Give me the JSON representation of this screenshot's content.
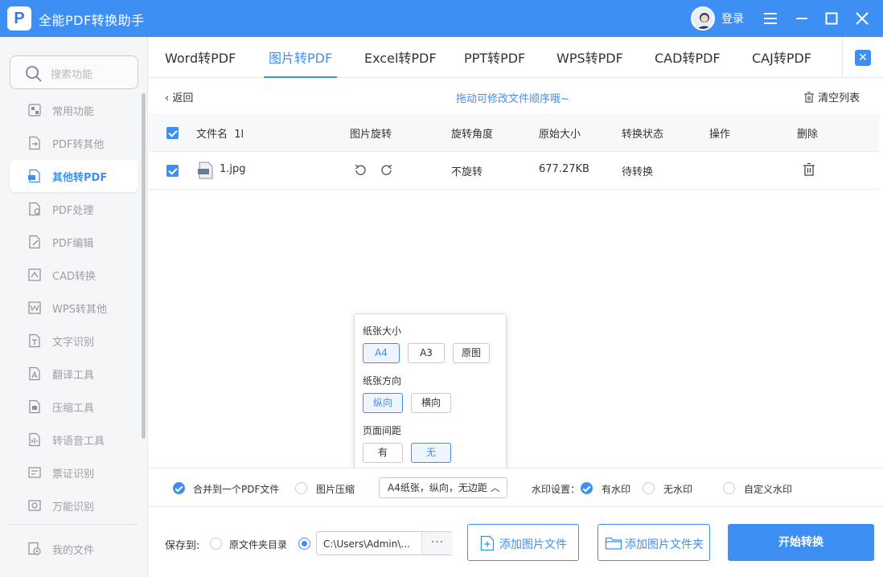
{
  "app": {
    "title": "全能PDF转换助手",
    "login": "登录"
  },
  "search": {
    "placeholder": "搜索功能"
  },
  "sidebar": {
    "items": [
      {
        "label": "常用功能",
        "icon": "common-icon"
      },
      {
        "label": "PDF转其他",
        "icon": "pdf-to-other-icon"
      },
      {
        "label": "其他转PDF",
        "icon": "other-to-pdf-icon",
        "active": true
      },
      {
        "label": "PDF处理",
        "icon": "pdf-process-icon"
      },
      {
        "label": "PDF编辑",
        "icon": "pdf-edit-icon"
      },
      {
        "label": "CAD转换",
        "icon": "cad-icon"
      },
      {
        "label": "WPS转其他",
        "icon": "wps-icon"
      },
      {
        "label": "文字识别",
        "icon": "ocr-icon"
      },
      {
        "label": "翻译工具",
        "icon": "translate-icon"
      },
      {
        "label": "压缩工具",
        "icon": "compress-icon"
      },
      {
        "label": "转语音工具",
        "icon": "speech-icon"
      },
      {
        "label": "票证识别",
        "icon": "ticket-icon"
      },
      {
        "label": "万能识别",
        "icon": "universal-icon"
      }
    ],
    "my_files": "我的文件"
  },
  "tabs": [
    "Word转PDF",
    "图片转PDF",
    "Excel转PDF",
    "PPT转PDF",
    "WPS转PDF",
    "CAD转PDF",
    "CAJ转PDF"
  ],
  "active_tab": "图片转PDF",
  "toolbar": {
    "back": "返回",
    "hint": "拖动可修改文件顺序哦~",
    "clear": "清空列表"
  },
  "table": {
    "headers": {
      "name": "文件名",
      "sort_mark": "1l",
      "rotate": "图片旋转",
      "angle": "旋转角度",
      "size": "原始大小",
      "status": "转换状态",
      "action": "操作",
      "delete": "删除"
    },
    "rows": [
      {
        "file": "1.jpg",
        "file_badge": "IMG",
        "angle": "不旋转",
        "size": "677.27KB",
        "status": "待转换"
      }
    ]
  },
  "popup": {
    "paper_size_label": "纸张大小",
    "paper_sizes": [
      "A4",
      "A3",
      "原图"
    ],
    "orientation_label": "纸张方向",
    "orientations": [
      "纵向",
      "横向"
    ],
    "margin_label": "页面间距",
    "margins": [
      "有",
      "无"
    ]
  },
  "options": {
    "merge": "合并到一个PDF文件",
    "compress": "图片压缩",
    "paper_setting": "A4纸张，纵向，无边距",
    "watermark_label": "水印设置：",
    "watermark_on": "有水印",
    "watermark_off": "无水印",
    "watermark_custom": "自定义水印"
  },
  "bottom": {
    "save_to": "保存到:",
    "orig_dir": "原文件夹目录",
    "path": "C:\\Users\\Admin\\...",
    "more": "···",
    "add_file": "添加图片文件",
    "add_folder": "添加图片文件夹",
    "start": "开始转换"
  },
  "colors": {
    "accent": "#3d8ff4",
    "title_bar": "#3d8ff4",
    "sidebar_bg": "#f5f6f8"
  }
}
